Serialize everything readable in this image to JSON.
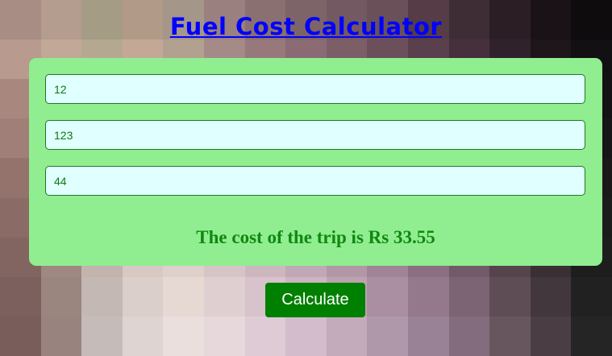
{
  "page": {
    "title": "Fuel Cost Calculator"
  },
  "form": {
    "distance_value": "12",
    "price_value": "123",
    "efficiency_value": "44"
  },
  "result": {
    "text": "The cost of the trip is Rs 33.55"
  },
  "actions": {
    "calculate_label": "Calculate"
  },
  "colors": {
    "title_link": "#0000ff",
    "panel_background": "#90ee90",
    "input_background": "#e0ffff",
    "result_text": "#118811",
    "button_background": "#008000",
    "button_text": "#ffffff"
  }
}
